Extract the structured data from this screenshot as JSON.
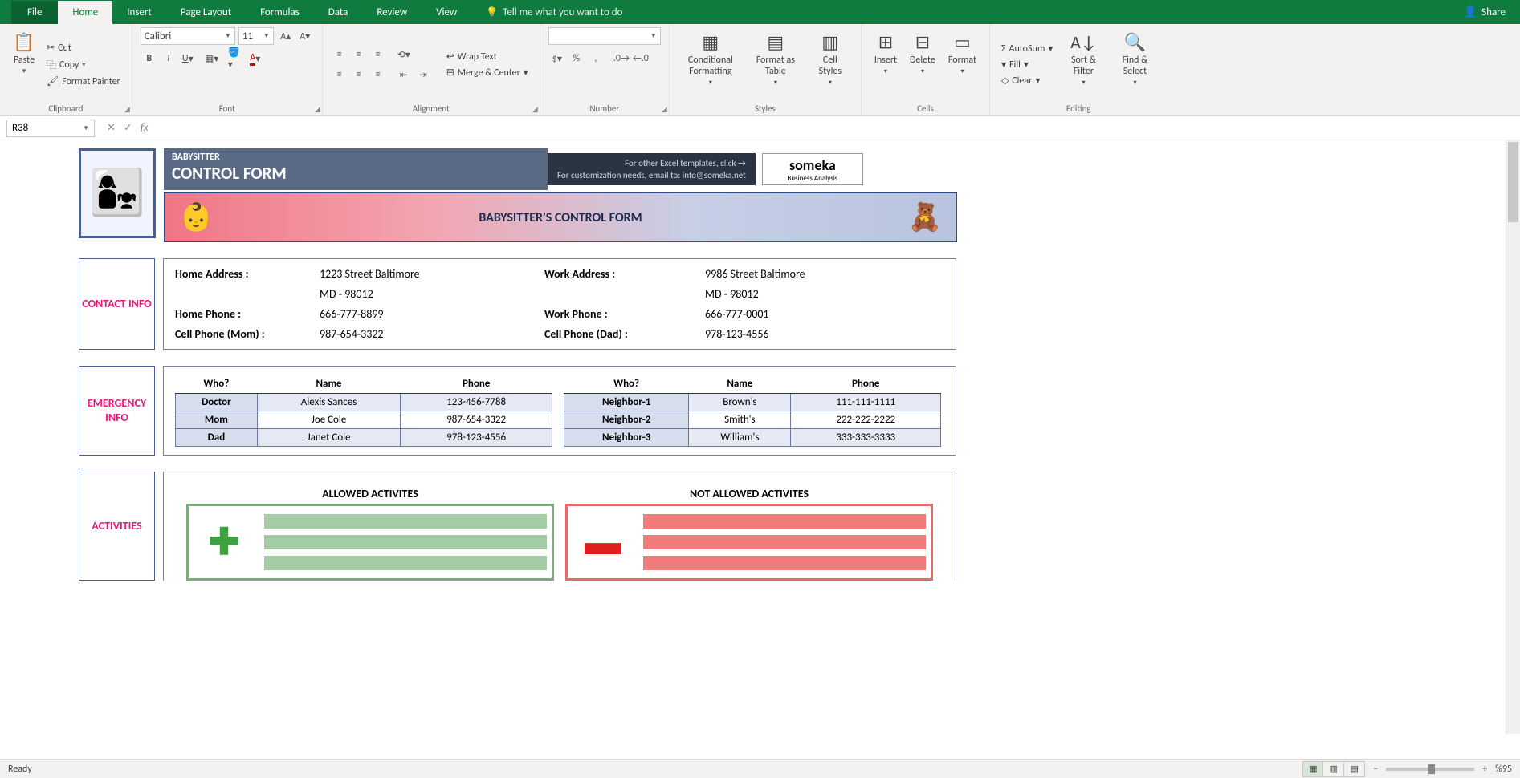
{
  "ribbon": {
    "tabs": {
      "file": "File",
      "home": "Home",
      "insert": "Insert",
      "pageLayout": "Page Layout",
      "formulas": "Formulas",
      "data": "Data",
      "review": "Review",
      "view": "View"
    },
    "tellme": "Tell me what you want to do",
    "share": "Share",
    "clipboard": {
      "paste": "Paste",
      "cut": "Cut",
      "copy": "Copy",
      "formatPainter": "Format Painter",
      "label": "Clipboard"
    },
    "font": {
      "name": "Calibri",
      "size": "11",
      "label": "Font"
    },
    "alignment": {
      "wrap": "Wrap Text",
      "merge": "Merge & Center",
      "label": "Alignment"
    },
    "number": {
      "label": "Number"
    },
    "styles": {
      "cond": "Conditional Formatting",
      "fmtTable": "Format as Table",
      "cellStyles": "Cell Styles",
      "label": "Styles"
    },
    "cells": {
      "insert": "Insert",
      "delete": "Delete",
      "format": "Format",
      "label": "Cells"
    },
    "editing": {
      "autosum": "AutoSum",
      "fill": "Fill",
      "clear": "Clear",
      "sort": "Sort & Filter",
      "find": "Find & Select",
      "label": "Editing"
    }
  },
  "namebox": "R38",
  "formula": "",
  "header": {
    "small": "BABYSITTER",
    "large": "CONTROL FORM",
    "note1": "For other Excel templates, click →",
    "note2": "For customization needs, email to: info@someka.net",
    "brand": "someka",
    "brandSub": "Business Analysis",
    "banner": "BABYSITTER'S CONTROL FORM"
  },
  "sections": {
    "contact": "CONTACT INFO",
    "emergency": "EMERGENCY INFO",
    "activities": "ACTIVITIES"
  },
  "contact": {
    "labels": {
      "homeAddr": "Home Address :",
      "homePhone": "Home Phone :",
      "cellMom": "Cell Phone (Mom) :",
      "workAddr": "Work Address :",
      "workPhone": "Work Phone :",
      "cellDad": "Cell Phone (Dad) :"
    },
    "homeAddr1": "1223 Street Baltimore",
    "homeAddr2": "MD - 98012",
    "homePhone": "666-777-8899",
    "cellMom": "987-654-3322",
    "workAddr1": "9986 Street Baltimore",
    "workAddr2": "MD - 98012",
    "workPhone": "666-777-0001",
    "cellDad": "978-123-4556"
  },
  "emergency": {
    "headers": {
      "who": "Who?",
      "name": "Name",
      "phone": "Phone"
    },
    "left": [
      {
        "who": "Doctor",
        "name": "Alexis Sances",
        "phone": "123-456-7788"
      },
      {
        "who": "Mom",
        "name": "Joe Cole",
        "phone": "987-654-3322"
      },
      {
        "who": "Dad",
        "name": "Janet Cole",
        "phone": "978-123-4556"
      }
    ],
    "right": [
      {
        "who": "Neighbor-1",
        "name": "Brown's",
        "phone": "111-111-1111"
      },
      {
        "who": "Neighbor-2",
        "name": "Smith's",
        "phone": "222-222-2222"
      },
      {
        "who": "Neighbor-3",
        "name": "William's",
        "phone": "333-333-3333"
      }
    ]
  },
  "activities": {
    "allowed": "ALLOWED ACTIVITES",
    "notAllowed": "NOT ALLOWED ACTIVITES"
  },
  "status": {
    "ready": "Ready",
    "zoom": "%95"
  }
}
